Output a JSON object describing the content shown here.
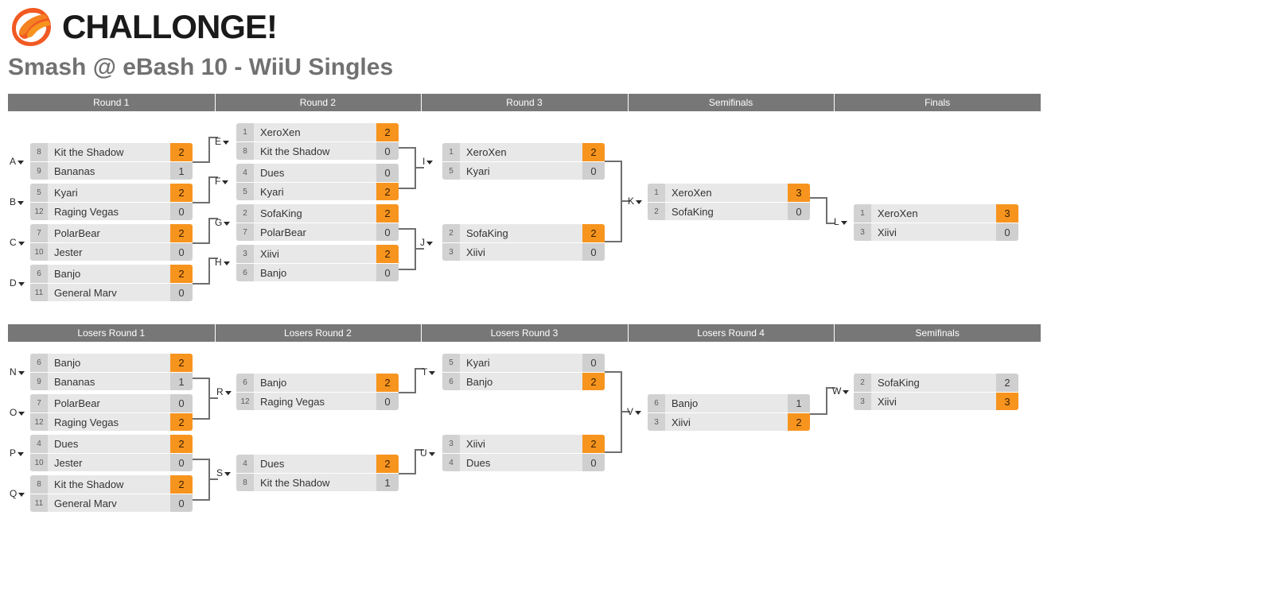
{
  "brand": {
    "logo_icon": "challonge-flame-logo",
    "wordmark": "CHALLONGE!"
  },
  "page_title": "Smash @ eBash 10 - WiiU Singles",
  "winners_bracket": {
    "rounds": [
      {
        "label": "Round 1"
      },
      {
        "label": "Round 2"
      },
      {
        "label": "Round 3"
      },
      {
        "label": "Semifinals"
      },
      {
        "label": "Finals"
      }
    ]
  },
  "losers_bracket": {
    "rounds": [
      {
        "label": "Losers Round 1"
      },
      {
        "label": "Losers Round 2"
      },
      {
        "label": "Losers Round 3"
      },
      {
        "label": "Losers Round 4"
      },
      {
        "label": "Semifinals"
      }
    ]
  },
  "matches": {
    "A": {
      "letter": "A",
      "top": {
        "seed": "8",
        "name": "Kit the Shadow",
        "score": "2",
        "winner": true
      },
      "bottom": {
        "seed": "9",
        "name": "Bananas",
        "score": "1",
        "winner": false
      }
    },
    "B": {
      "letter": "B",
      "top": {
        "seed": "5",
        "name": "Kyari",
        "score": "2",
        "winner": true
      },
      "bottom": {
        "seed": "12",
        "name": "Raging Vegas",
        "score": "0",
        "winner": false
      }
    },
    "C": {
      "letter": "C",
      "top": {
        "seed": "7",
        "name": "PolarBear",
        "score": "2",
        "winner": true
      },
      "bottom": {
        "seed": "10",
        "name": "Jester",
        "score": "0",
        "winner": false
      }
    },
    "D": {
      "letter": "D",
      "top": {
        "seed": "6",
        "name": "Banjo",
        "score": "2",
        "winner": true
      },
      "bottom": {
        "seed": "11",
        "name": "General Marv",
        "score": "0",
        "winner": false
      }
    },
    "E": {
      "letter": "E",
      "top": {
        "seed": "1",
        "name": "XeroXen",
        "score": "2",
        "winner": true
      },
      "bottom": {
        "seed": "8",
        "name": "Kit the Shadow",
        "score": "0",
        "winner": false
      }
    },
    "F": {
      "letter": "F",
      "top": {
        "seed": "4",
        "name": "Dues",
        "score": "0",
        "winner": false
      },
      "bottom": {
        "seed": "5",
        "name": "Kyari",
        "score": "2",
        "winner": true
      }
    },
    "G": {
      "letter": "G",
      "top": {
        "seed": "2",
        "name": "SofaKing",
        "score": "2",
        "winner": true
      },
      "bottom": {
        "seed": "7",
        "name": "PolarBear",
        "score": "0",
        "winner": false
      }
    },
    "H": {
      "letter": "H",
      "top": {
        "seed": "3",
        "name": "Xiivi",
        "score": "2",
        "winner": true
      },
      "bottom": {
        "seed": "6",
        "name": "Banjo",
        "score": "0",
        "winner": false
      }
    },
    "I": {
      "letter": "I",
      "top": {
        "seed": "1",
        "name": "XeroXen",
        "score": "2",
        "winner": true
      },
      "bottom": {
        "seed": "5",
        "name": "Kyari",
        "score": "0",
        "winner": false
      }
    },
    "J": {
      "letter": "J",
      "top": {
        "seed": "2",
        "name": "SofaKing",
        "score": "2",
        "winner": true
      },
      "bottom": {
        "seed": "3",
        "name": "Xiivi",
        "score": "0",
        "winner": false
      }
    },
    "K": {
      "letter": "K",
      "top": {
        "seed": "1",
        "name": "XeroXen",
        "score": "3",
        "winner": true
      },
      "bottom": {
        "seed": "2",
        "name": "SofaKing",
        "score": "0",
        "winner": false
      }
    },
    "L": {
      "letter": "L",
      "top": {
        "seed": "1",
        "name": "XeroXen",
        "score": "3",
        "winner": true
      },
      "bottom": {
        "seed": "3",
        "name": "Xiivi",
        "score": "0",
        "winner": false
      }
    },
    "N": {
      "letter": "N",
      "top": {
        "seed": "6",
        "name": "Banjo",
        "score": "2",
        "winner": true
      },
      "bottom": {
        "seed": "9",
        "name": "Bananas",
        "score": "1",
        "winner": false
      }
    },
    "O": {
      "letter": "O",
      "top": {
        "seed": "7",
        "name": "PolarBear",
        "score": "0",
        "winner": false
      },
      "bottom": {
        "seed": "12",
        "name": "Raging Vegas",
        "score": "2",
        "winner": true
      }
    },
    "P": {
      "letter": "P",
      "top": {
        "seed": "4",
        "name": "Dues",
        "score": "2",
        "winner": true
      },
      "bottom": {
        "seed": "10",
        "name": "Jester",
        "score": "0",
        "winner": false
      }
    },
    "Q": {
      "letter": "Q",
      "top": {
        "seed": "8",
        "name": "Kit the Shadow",
        "score": "2",
        "winner": true
      },
      "bottom": {
        "seed": "11",
        "name": "General Marv",
        "score": "0",
        "winner": false
      }
    },
    "R": {
      "letter": "R",
      "top": {
        "seed": "6",
        "name": "Banjo",
        "score": "2",
        "winner": true
      },
      "bottom": {
        "seed": "12",
        "name": "Raging Vegas",
        "score": "0",
        "winner": false
      }
    },
    "S": {
      "letter": "S",
      "top": {
        "seed": "4",
        "name": "Dues",
        "score": "2",
        "winner": true
      },
      "bottom": {
        "seed": "8",
        "name": "Kit the Shadow",
        "score": "1",
        "winner": false
      }
    },
    "T": {
      "letter": "T",
      "top": {
        "seed": "5",
        "name": "Kyari",
        "score": "0",
        "winner": false
      },
      "bottom": {
        "seed": "6",
        "name": "Banjo",
        "score": "2",
        "winner": true
      }
    },
    "U": {
      "letter": "U",
      "top": {
        "seed": "3",
        "name": "Xiivi",
        "score": "2",
        "winner": true
      },
      "bottom": {
        "seed": "4",
        "name": "Dues",
        "score": "0",
        "winner": false
      }
    },
    "V": {
      "letter": "V",
      "top": {
        "seed": "6",
        "name": "Banjo",
        "score": "1",
        "winner": false
      },
      "bottom": {
        "seed": "3",
        "name": "Xiivi",
        "score": "2",
        "winner": true
      }
    },
    "W": {
      "letter": "W",
      "top": {
        "seed": "2",
        "name": "SofaKing",
        "score": "2",
        "winner": false
      },
      "bottom": {
        "seed": "3",
        "name": "Xiivi",
        "score": "3",
        "winner": true
      }
    }
  },
  "colors": {
    "accent_orange": "#f7941e",
    "header_grey": "#777777",
    "row_grey": "#e8e8e8",
    "seed_grey": "#d2d2d2",
    "title_grey": "#717171"
  }
}
